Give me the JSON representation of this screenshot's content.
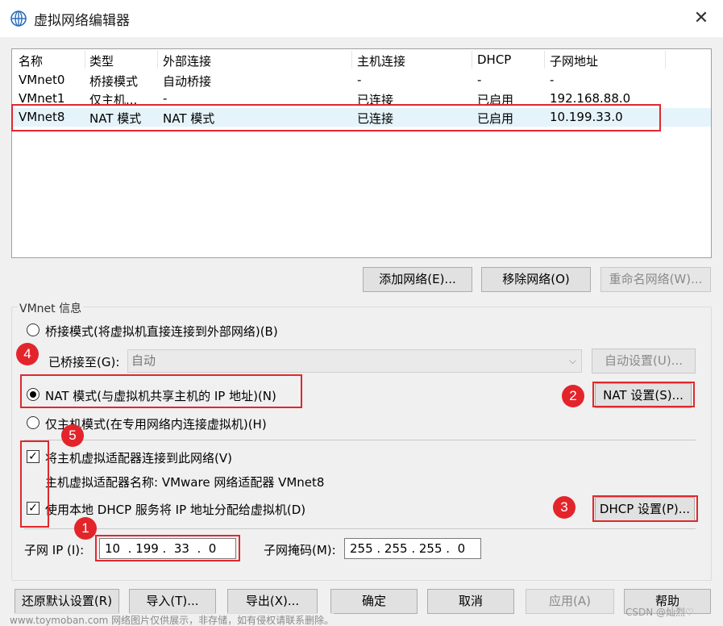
{
  "window": {
    "title": "虚拟网络编辑器",
    "close_glyph": "✕"
  },
  "table": {
    "headers": [
      "名称",
      "类型",
      "外部连接",
      "主机连接",
      "DHCP",
      "子网地址"
    ],
    "rows": [
      [
        "VMnet0",
        "桥接模式",
        "自动桥接",
        "-",
        "-",
        "-"
      ],
      [
        "VMnet1",
        "仅主机...",
        "-",
        "已连接",
        "已启用",
        "192.168.88.0"
      ],
      [
        "VMnet8",
        "NAT 模式",
        "NAT 模式",
        "已连接",
        "已启用",
        "10.199.33.0"
      ]
    ]
  },
  "list_buttons": {
    "add": "添加网络(E)...",
    "remove": "移除网络(O)",
    "rename": "重命名网络(W)..."
  },
  "info": {
    "group_label": "VMnet 信息",
    "bridge_radio": "桥接模式(将虚拟机直接连接到外部网络)(B)",
    "bridged_to_label": "已桥接至(G):",
    "bridged_to_value": "自动",
    "auto_settings": "自动设置(U)...",
    "nat_radio": "NAT 模式(与虚拟机共享主机的 IP 地址)(N)",
    "nat_settings": "NAT 设置(S)...",
    "hostonly_radio": "仅主机模式(在专用网络内连接虚拟机)(H)",
    "connect_adapter": "将主机虚拟适配器连接到此网络(V)",
    "adapter_name": "主机虚拟适配器名称: VMware 网络适配器 VMnet8",
    "use_dhcp": "使用本地 DHCP 服务将 IP 地址分配给虚拟机(D)",
    "dhcp_settings": "DHCP 设置(P)...",
    "subnet_ip_label": "子网 IP (I):",
    "subnet_ip": "10  . 199 .  33  .  0",
    "subnet_mask_label": "子网掩码(M):",
    "subnet_mask": "255 . 255 . 255 .  0"
  },
  "badges": [
    "1",
    "2",
    "3",
    "4",
    "5"
  ],
  "bottom_buttons": {
    "restore": "还原默认设置(R)",
    "import": "导入(T)...",
    "export": "导出(X)...",
    "ok": "确定",
    "cancel": "取消",
    "apply": "应用(A)",
    "help": "帮助"
  },
  "watermark": "www.toymoban.com 网络图片仅供展示，非存储，如有侵权请联系删除。",
  "watermark_right": "CSDN @灿烈♡",
  "colors": {
    "annotation_red": "#e0282e",
    "badge_red": "#e3242b",
    "selected_row": "#e5f3fb"
  }
}
